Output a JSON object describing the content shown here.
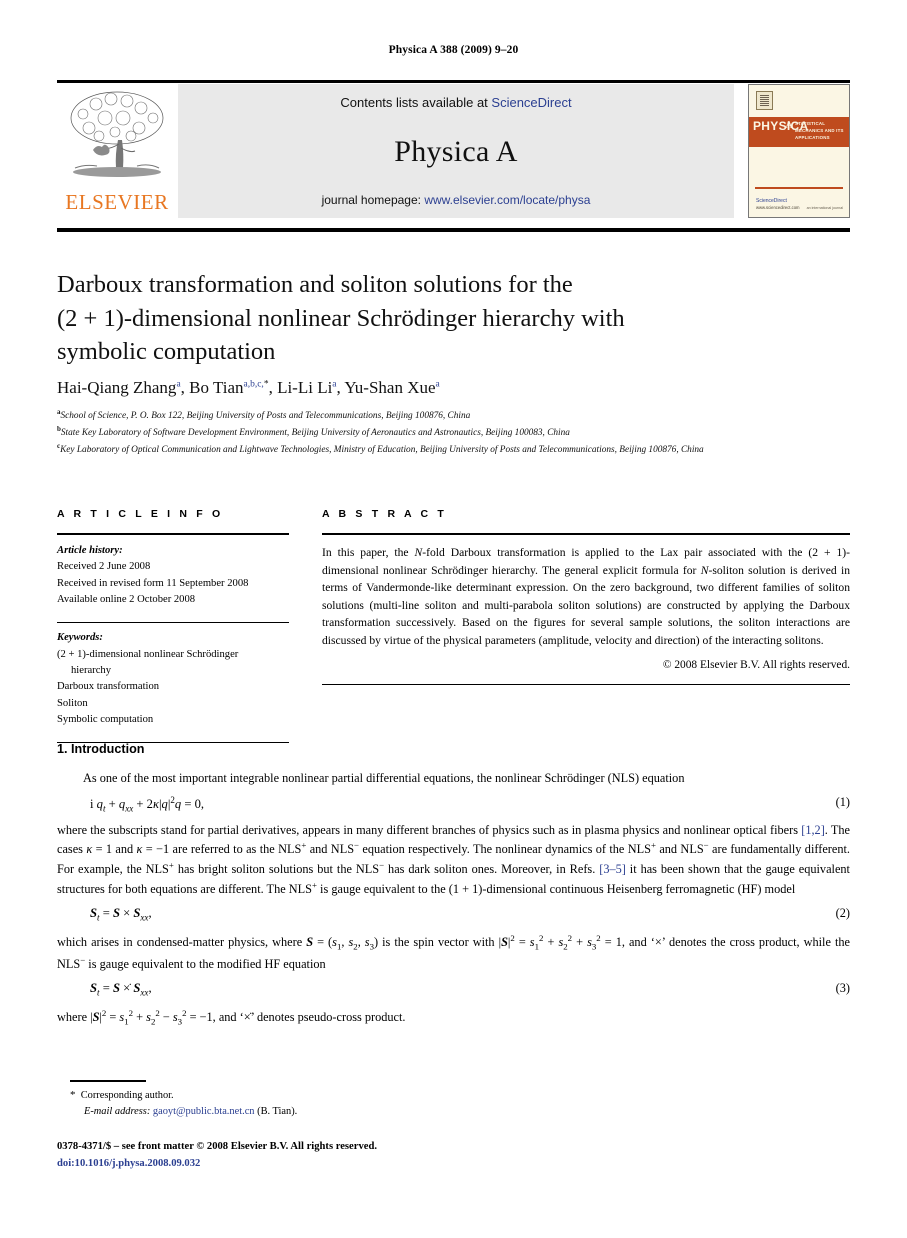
{
  "running_head": "Physica A 388 (2009) 9–20",
  "banner": {
    "contents_prefix": "Contents lists available at ",
    "sciencedirect": "ScienceDirect",
    "journal_name": "Physica A",
    "homepage_prefix": "journal homepage: ",
    "homepage_url": "www.elsevier.com/locate/physa",
    "publisher": "ELSEVIER",
    "logo_icon": "elsevier-tree-logo",
    "cover": {
      "title": "PHYSICA",
      "volume_letter": "A",
      "subtitle": "STATISTICAL MECHANICS AND ITS APPLICATIONS",
      "available_online": "Available online at",
      "sciencedirect": "ScienceDirect",
      "url": "www.sciencedirect.com",
      "right_note": "an international journal"
    }
  },
  "article": {
    "title_line1": "Darboux transformation and soliton solutions for the",
    "title_line2": "(2 + 1)-dimensional nonlinear Schrödinger hierarchy with",
    "title_line3": "symbolic computation",
    "authors": [
      {
        "name": "Hai-Qiang Zhang",
        "marks": "a",
        "sep": ", "
      },
      {
        "name": "Bo Tian",
        "marks": "a,b,c,",
        "star": "*",
        "sep": ", "
      },
      {
        "name": "Li-Li Li",
        "marks": "a",
        "sep": ", "
      },
      {
        "name": "Yu-Shan Xue",
        "marks": "a",
        "sep": ""
      }
    ],
    "affiliations": [
      {
        "mark": "a",
        "text": "School of Science, P. O. Box 122, Beijing University of Posts and Telecommunications, Beijing 100876, China"
      },
      {
        "mark": "b",
        "text": "State Key Laboratory of Software Development Environment, Beijing University of Aeronautics and Astronautics, Beijing 100083, China"
      },
      {
        "mark": "c",
        "text": "Key Laboratory of Optical Communication and Lightwave Technologies, Ministry of Education, Beijing University of Posts and Telecommunications, Beijing 100876, China"
      }
    ]
  },
  "info": {
    "heading": "A R T I C L E   I N F O",
    "history_label": "Article history:",
    "history": [
      "Received 2 June 2008",
      "Received in revised form 11 September 2008",
      "Available online 2 October 2008"
    ],
    "keywords_label": "Keywords:",
    "keywords": [
      "(2 + 1)-dimensional nonlinear Schrödinger",
      "hierarchy",
      "Darboux transformation",
      "Soliton",
      "Symbolic computation"
    ]
  },
  "abstract": {
    "heading": "A B S T R A C T",
    "text_parts": [
      {
        "t": "In this paper, the ",
        "style": ""
      },
      {
        "t": "N",
        "style": "it"
      },
      {
        "t": "-fold Darboux transformation is applied to the Lax pair associated with the (2 + 1)-dimensional nonlinear Schrödinger hierarchy. The general explicit formula for ",
        "style": ""
      },
      {
        "t": "N",
        "style": "it"
      },
      {
        "t": "-soliton solution is derived in terms of Vandermonde-like determinant expression. On the zero background, two different families of soliton solutions (multi-line soliton and multi-parabola soliton solutions) are constructed by applying the Darboux transformation successively. Based on the figures for several sample solutions, the soliton interactions are discussed by virtue of the physical parameters (amplitude, velocity and direction) of the interacting solitons.",
        "style": ""
      }
    ],
    "copyright": "© 2008 Elsevier B.V. All rights reserved."
  },
  "body": {
    "section_heading": "1. Introduction",
    "para1": "As one of the most important integrable nonlinear partial differential equations, the nonlinear Schrödinger (NLS) equation",
    "eq1_num": "(1)",
    "para2": "where the subscripts stand for partial derivatives, appears in many different branches of physics such as in plasma physics and nonlinear optical fibers [1,2]. The cases κ = 1 and κ = −1 are referred to as the NLS⁺ and NLS⁻ equation respectively. The nonlinear dynamics of the NLS⁺ and NLS⁻ are fundamentally different. For example, the NLS⁺ has bright soliton solutions but the NLS⁻ has dark soliton ones. Moreover, in Refs. [3–5] it has been shown that the gauge equivalent structures for both equations are different. The NLS⁺ is gauge equivalent to the (1 + 1)-dimensional continuous Heisenberg ferromagnetic (HF) model",
    "ref_1_2": "[1,2]",
    "ref_3_5": "[3–5]",
    "eq2_num": "(2)",
    "para3": "which arises in condensed-matter physics, where S = (s₁, s₂, s₃) is the spin vector with |S|² = s₁² + s₂² + s₃² = 1, and 'x' denotes the cross product, while the NLS⁻ is gauge equivalent to the modified HF equation",
    "eq3_num": "(3)",
    "para4": "where |S|² = s₁² + s₂² − s₃² = −1, and 'ẋ' denotes pseudo-cross product."
  },
  "footnotes": {
    "star": "*",
    "corresponding": "Corresponding author.",
    "email_label": "E-mail address:",
    "email": "gaoyt@public.bta.net.cn",
    "email_owner": "(B. Tian).",
    "imprint": "0378-4371/$ – see front matter © 2008 Elsevier B.V. All rights reserved.",
    "doi": "doi:10.1016/j.physa.2008.09.032"
  },
  "colors": {
    "link": "#2b3f91",
    "elsevier_orange": "#E87722",
    "banner_bg": "#e9e9e9",
    "cover_cream": "#fbf6e4",
    "cover_orange": "#bf4b1e"
  }
}
